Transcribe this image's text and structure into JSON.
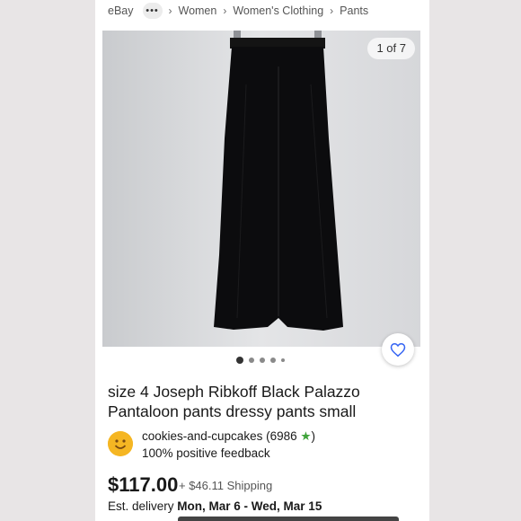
{
  "breadcrumb": {
    "root": "eBay",
    "more": "•••",
    "items": [
      "Women",
      "Women's Clothing",
      "Pants"
    ]
  },
  "gallery": {
    "counter": "1 of 7",
    "dots": 5,
    "active_dot": 0,
    "image_description_icon": "black-wide-leg-pants-photo"
  },
  "listing": {
    "title": "size 4 Joseph Ribkoff Black Palazzo Pantaloon pants dressy pants  small",
    "price": "$117.00",
    "shipping": "+ $46.11 Shipping",
    "delivery_label": "Est. delivery",
    "delivery_dates": "Mon, Mar 6 - Wed, Mar 15"
  },
  "seller": {
    "name": "cookies-and-cupcakes",
    "count_open": "(6986",
    "count_close": ")",
    "star": "★",
    "feedback": "100% positive feedback"
  },
  "colors": {
    "background": "#e8e5e6",
    "star": "#3fa33a",
    "heart": "#3665f3",
    "avatar": "#f5b623"
  }
}
